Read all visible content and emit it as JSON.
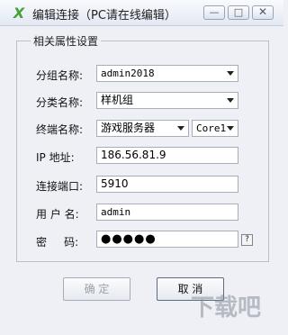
{
  "window": {
    "title": "编辑连接（PC请在线编辑）",
    "icon": "app-x-logo-icon",
    "controls": {
      "minimize": "—",
      "maximize": "□",
      "close": "✕"
    }
  },
  "group": {
    "legend": "相关属性设置"
  },
  "fields": {
    "group_name": {
      "label": "分组名称:",
      "value": "admin2018"
    },
    "category_name": {
      "label": "分类名称:",
      "value": "样机组"
    },
    "terminal_name": {
      "label": "终端名称:",
      "value": "游戏服务器",
      "sub_value": "Core1"
    },
    "ip_address": {
      "label": "IP  地址:",
      "value": "186.56.81.9"
    },
    "port": {
      "label": "连接端口:",
      "value": "5910"
    },
    "username": {
      "label": "用 户 名:",
      "value": "admin"
    },
    "password": {
      "label": "密     码:",
      "value": "●●●●●"
    }
  },
  "help_button": {
    "label": "?"
  },
  "buttons": {
    "ok": "确 定",
    "cancel": "取 消"
  },
  "watermark": {
    "text": "下载吧"
  }
}
